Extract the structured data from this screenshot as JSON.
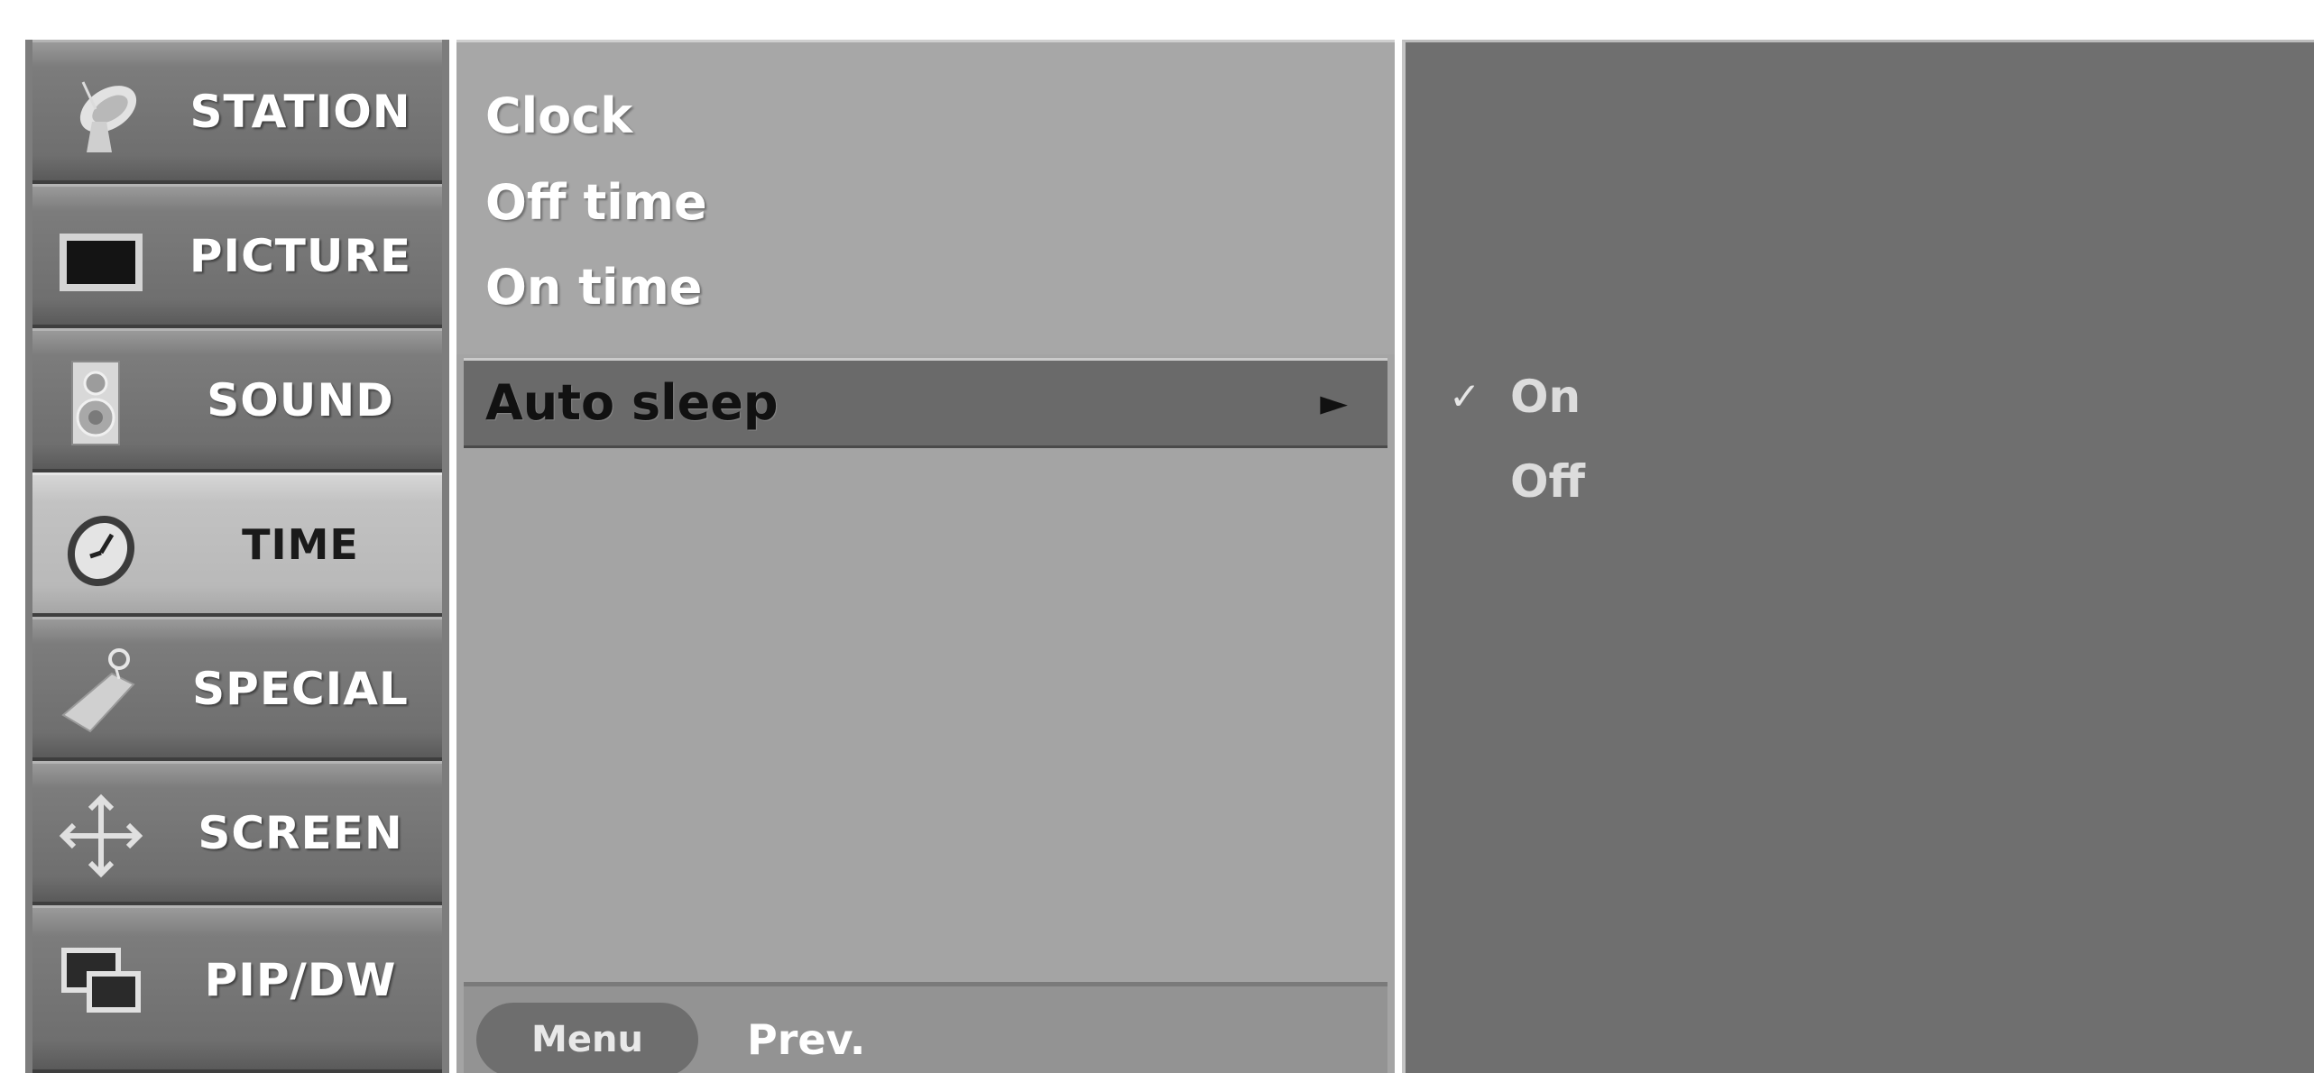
{
  "categories": [
    {
      "label": "STATION",
      "icon": "satellite-dish-icon",
      "selected": false
    },
    {
      "label": "PICTURE",
      "icon": "monitor-screen-icon",
      "selected": false
    },
    {
      "label": "SOUND",
      "icon": "speaker-icon",
      "selected": false
    },
    {
      "label": "TIME",
      "icon": "clock-icon",
      "selected": true
    },
    {
      "label": "SPECIAL",
      "icon": "tag-icon",
      "selected": false
    },
    {
      "label": "SCREEN",
      "icon": "move-arrows-icon",
      "selected": false
    },
    {
      "label": "PIP/DW",
      "icon": "pip-windows-icon",
      "selected": false
    }
  ],
  "submenu": {
    "items": [
      {
        "label": "Clock"
      },
      {
        "label": "Off time"
      },
      {
        "label": "On time"
      }
    ],
    "selected": {
      "label": "Auto sleep",
      "arrow": "►"
    }
  },
  "options": {
    "check_mark": "✓",
    "items": [
      {
        "label": "On",
        "checked": true
      },
      {
        "label": "Off",
        "checked": false
      }
    ]
  },
  "footer": {
    "menu_key": "Menu",
    "prev_label": "Prev."
  }
}
